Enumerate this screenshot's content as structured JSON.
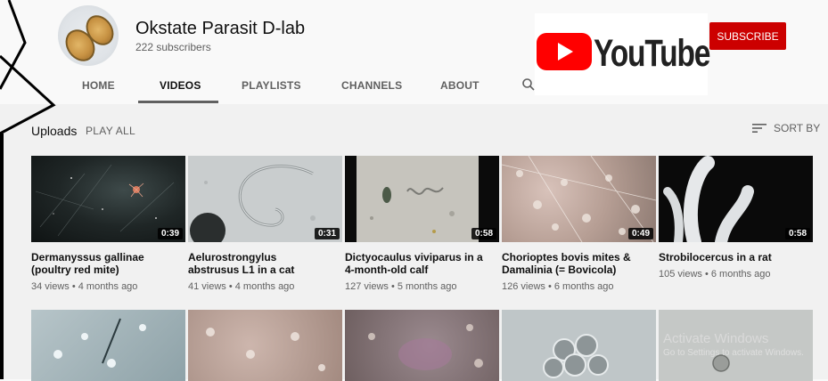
{
  "channel": {
    "name": "Okstate Parasit D-lab",
    "subscribers": "222 subscribers"
  },
  "youtube_logo_text": "YouTube",
  "subscribe_label": "SUBSCRIBE",
  "tabs": [
    {
      "label": "HOME",
      "active": false
    },
    {
      "label": "VIDEOS",
      "active": true
    },
    {
      "label": "PLAYLISTS",
      "active": false
    },
    {
      "label": "CHANNELS",
      "active": false
    },
    {
      "label": "ABOUT",
      "active": false
    }
  ],
  "section": {
    "title": "Uploads",
    "play_all": "PLAY ALL",
    "sort_by": "SORT BY"
  },
  "videos": [
    {
      "title": "Dermanyssus gallinae (poultry red mite)",
      "duration": "0:39",
      "meta": "34 views • 4 months ago"
    },
    {
      "title": "Aelurostrongylus abstrusus L1 in a cat",
      "duration": "0:31",
      "meta": "41 views • 4 months ago"
    },
    {
      "title": "Dictyocaulus viviparus in a 4-month-old calf",
      "duration": "0:58",
      "meta": "127 views • 5 months ago"
    },
    {
      "title": "Chorioptes bovis mites & Damalinia (= Bovicola) capr…",
      "duration": "0:49",
      "meta": "126 views • 6 months ago"
    },
    {
      "title": "Strobilocercus in a rat",
      "duration": "0:58",
      "meta": "105 views • 6 months ago"
    }
  ],
  "watermark": {
    "line1": "Activate Windows",
    "line2": "Go to Settings to activate Windows."
  },
  "colors": {
    "brand_red": "#cc0000",
    "youtube_red": "#ff0000",
    "background": "#f9f9f9"
  }
}
